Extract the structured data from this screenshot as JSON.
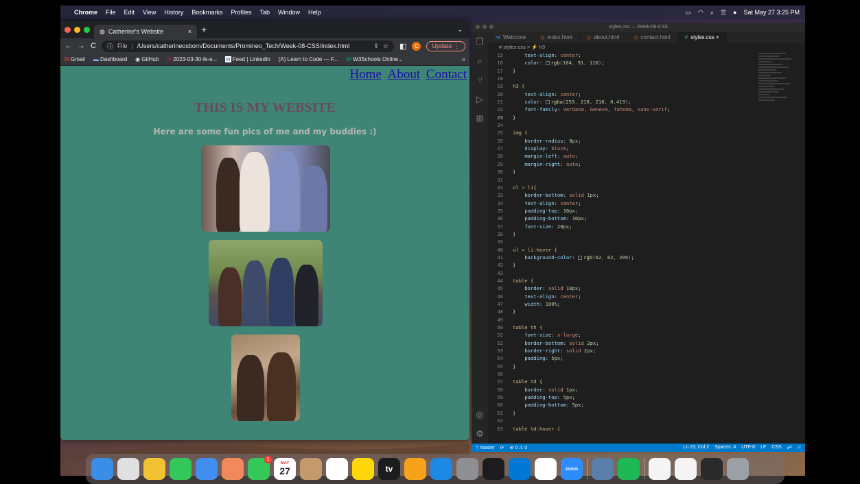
{
  "menubar": {
    "app": "Chrome",
    "items": [
      "File",
      "Edit",
      "View",
      "History",
      "Bookmarks",
      "Profiles",
      "Tab",
      "Window",
      "Help"
    ],
    "datetime": "Sat May 27  3:25 PM"
  },
  "chrome": {
    "tab_title": "Catherine's Website",
    "tab_close": "×",
    "new_tab": "+",
    "url_prefix": "File",
    "url": "/Users/catherineosborn/Documents/Promineo_Tech/Week-08-CSS/index.html",
    "update_label": "Update",
    "profile_initial": "C",
    "bookmarks": [
      "Gmail",
      "Dashboard",
      "GitHub",
      "2023-03-30-fe-e...",
      "Feed | LinkedIn",
      "Learn to Code — F...",
      "W3Schools Online..."
    ],
    "bookmarks_more": "»"
  },
  "webpage": {
    "nav": [
      "Home",
      "About",
      "Contact"
    ],
    "heading": "THIS IS MY WEBSITE",
    "subheading": "Here are some fun pics of me and my buddies :)"
  },
  "vscode": {
    "title": "styles.css — Week-08-CSS",
    "tabs": [
      {
        "label": "Welcome",
        "icon": "vscode-icon"
      },
      {
        "label": "index.html",
        "icon": "html-icon"
      },
      {
        "label": "about.html",
        "icon": "html-icon"
      },
      {
        "label": "contact.html",
        "icon": "html-icon"
      },
      {
        "label": "styles.css",
        "icon": "css-icon"
      }
    ],
    "breadcrumb": "# styles.css > ⚡ h3",
    "status": {
      "branch": "master",
      "problems": "⊗ 0 ⚠ 0",
      "position": "Ln 23, Col 2",
      "spaces": "Spaces: 4",
      "encoding": "UTF-8",
      "eol": "LF",
      "language": "CSS"
    },
    "code": [
      {
        "n": "15",
        "t": "    text-align: center;"
      },
      {
        "n": "16",
        "t": "    color: rgb(104, 91, 110);"
      },
      {
        "n": "17",
        "t": "}"
      },
      {
        "n": "18",
        "t": ""
      },
      {
        "n": "19",
        "t": "h3 {"
      },
      {
        "n": "20",
        "t": "    text-align: center;"
      },
      {
        "n": "21",
        "t": "    color: rgba(255, 218, 218, 0.419);"
      },
      {
        "n": "22",
        "t": "    font-family: Verdana, Geneva, Tahoma, sans-serif;"
      },
      {
        "n": "23",
        "t": "}"
      },
      {
        "n": "24",
        "t": ""
      },
      {
        "n": "25",
        "t": "img {"
      },
      {
        "n": "26",
        "t": "    border-radius: 8px;"
      },
      {
        "n": "27",
        "t": "    display: block;"
      },
      {
        "n": "28",
        "t": "    margin-left: auto;"
      },
      {
        "n": "29",
        "t": "    margin-right: auto;"
      },
      {
        "n": "30",
        "t": "}"
      },
      {
        "n": "31",
        "t": ""
      },
      {
        "n": "32",
        "t": "ol > li{"
      },
      {
        "n": "33",
        "t": "    border-bottom: solid 1px;"
      },
      {
        "n": "34",
        "t": "    text-align: center;"
      },
      {
        "n": "35",
        "t": "    padding-top: 10px;"
      },
      {
        "n": "36",
        "t": "    padding-bottom: 10px;"
      },
      {
        "n": "37",
        "t": "    font-size: 20px;"
      },
      {
        "n": "38",
        "t": "}"
      },
      {
        "n": "39",
        "t": ""
      },
      {
        "n": "40",
        "t": "ol > li:hover {"
      },
      {
        "n": "41",
        "t": "    background-color: rgb(62, 62, 209);"
      },
      {
        "n": "42",
        "t": "}"
      },
      {
        "n": "43",
        "t": ""
      },
      {
        "n": "44",
        "t": "table {"
      },
      {
        "n": "45",
        "t": "    border: solid 10px;"
      },
      {
        "n": "46",
        "t": "    text-align: center;"
      },
      {
        "n": "47",
        "t": "    width: 100%;"
      },
      {
        "n": "48",
        "t": "}"
      },
      {
        "n": "49",
        "t": ""
      },
      {
        "n": "50",
        "t": "table th {"
      },
      {
        "n": "51",
        "t": "    font-size: x-large;"
      },
      {
        "n": "52",
        "t": "    border-bottom: solid 2px;"
      },
      {
        "n": "53",
        "t": "    border-right: solid 2px;"
      },
      {
        "n": "54",
        "t": "    padding: 5px;"
      },
      {
        "n": "55",
        "t": "}"
      },
      {
        "n": "56",
        "t": ""
      },
      {
        "n": "57",
        "t": "table td {"
      },
      {
        "n": "58",
        "t": "    border: solid 1px;"
      },
      {
        "n": "59",
        "t": "    padding-top: 5px;"
      },
      {
        "n": "60",
        "t": "    padding-bottom: 5px;"
      },
      {
        "n": "61",
        "t": "}"
      },
      {
        "n": "62",
        "t": ""
      },
      {
        "n": "63",
        "t": "table td:hover {"
      }
    ]
  },
  "dock": {
    "apps": [
      {
        "name": "finder",
        "color": "#3b8ee8"
      },
      {
        "name": "launchpad",
        "color": "#e0e0e0"
      },
      {
        "name": "chrome",
        "color": "#f1c232"
      },
      {
        "name": "messages",
        "color": "#34c759"
      },
      {
        "name": "mail",
        "color": "#3f8ef0"
      },
      {
        "name": "photos",
        "color": "#f08a5d"
      },
      {
        "name": "facetime",
        "color": "#34c759"
      },
      {
        "name": "calendar",
        "color": "#ffffff"
      },
      {
        "name": "contacts",
        "color": "#c49a6c"
      },
      {
        "name": "reminders",
        "color": "#ffffff"
      },
      {
        "name": "notes",
        "color": "#ffd60a"
      },
      {
        "name": "appletv",
        "color": "#1c1c1e"
      },
      {
        "name": "pages",
        "color": "#f7a21b"
      },
      {
        "name": "appstore",
        "color": "#1e88e5"
      },
      {
        "name": "settings",
        "color": "#8e8e93"
      },
      {
        "name": "terminal",
        "color": "#1c1c1e"
      },
      {
        "name": "vscode",
        "color": "#0078d4"
      },
      {
        "name": "slack",
        "color": "#ffffff"
      },
      {
        "name": "zoom",
        "color": "#2d8cff"
      },
      {
        "name": "preview",
        "color": "#5a7fa8"
      },
      {
        "name": "spotify",
        "color": "#1db954"
      },
      {
        "name": "document",
        "color": "#f5f5f5"
      },
      {
        "name": "document2",
        "color": "#f5f5f5"
      },
      {
        "name": "window",
        "color": "#2a2a2a"
      },
      {
        "name": "trash",
        "color": "#9aa0a6"
      }
    ],
    "calendar_month": "MAY",
    "calendar_day": "27",
    "facetime_badge": "1",
    "appletv_label": "tv",
    "zoom_label": "zoom"
  }
}
